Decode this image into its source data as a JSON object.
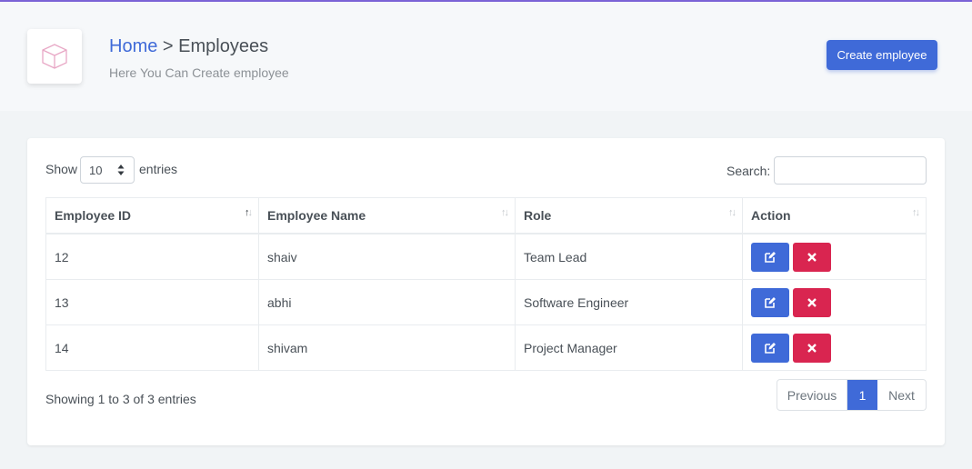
{
  "header": {
    "breadcrumb_home": "Home",
    "breadcrumb_sep": ">",
    "breadcrumb_current": "Employees",
    "subtitle": "Here You Can Create employee",
    "create_button": "Create employee"
  },
  "length_menu": {
    "prefix": "Show",
    "value": "10",
    "suffix": "entries"
  },
  "search": {
    "label": "Search:",
    "value": ""
  },
  "table": {
    "columns": [
      "Employee ID",
      "Employee Name",
      "Role",
      "Action"
    ],
    "rows": [
      {
        "id": "12",
        "name": "shaiv",
        "role": "Team Lead"
      },
      {
        "id": "13",
        "name": "abhi",
        "role": "Software Engineer"
      },
      {
        "id": "14",
        "name": "shivam",
        "role": "Project Manager"
      }
    ]
  },
  "info": "Showing 1 to 3 of 3 entries",
  "pagination": {
    "previous": "Previous",
    "current": "1",
    "next": "Next"
  },
  "colors": {
    "accent": "#3f6ad8",
    "danger": "#d92550",
    "top_line": "#7b63d6"
  }
}
